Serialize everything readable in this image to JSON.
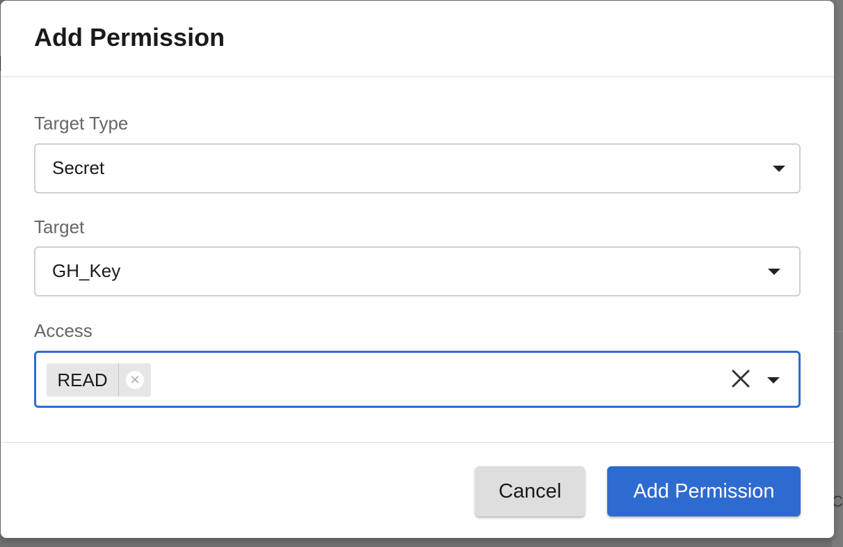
{
  "dialog": {
    "title": "Add Permission"
  },
  "form": {
    "target_type": {
      "label": "Target Type",
      "value": "Secret"
    },
    "target": {
      "label": "Target",
      "value": "GH_Key"
    },
    "access": {
      "label": "Access",
      "chips": [
        "READ"
      ]
    }
  },
  "buttons": {
    "cancel": "Cancel",
    "submit": "Add Permission"
  },
  "background": {
    "partial_text": "CE"
  },
  "colors": {
    "primary": "#2e6bd1",
    "focus_border": "#2e6bd1",
    "cancel_bg": "#dedede",
    "chip_bg": "#e6e6e6"
  },
  "icons": {
    "select_caret": "chevron-down-icon",
    "clear": "close-icon",
    "chip_remove": "remove-chip-icon"
  }
}
